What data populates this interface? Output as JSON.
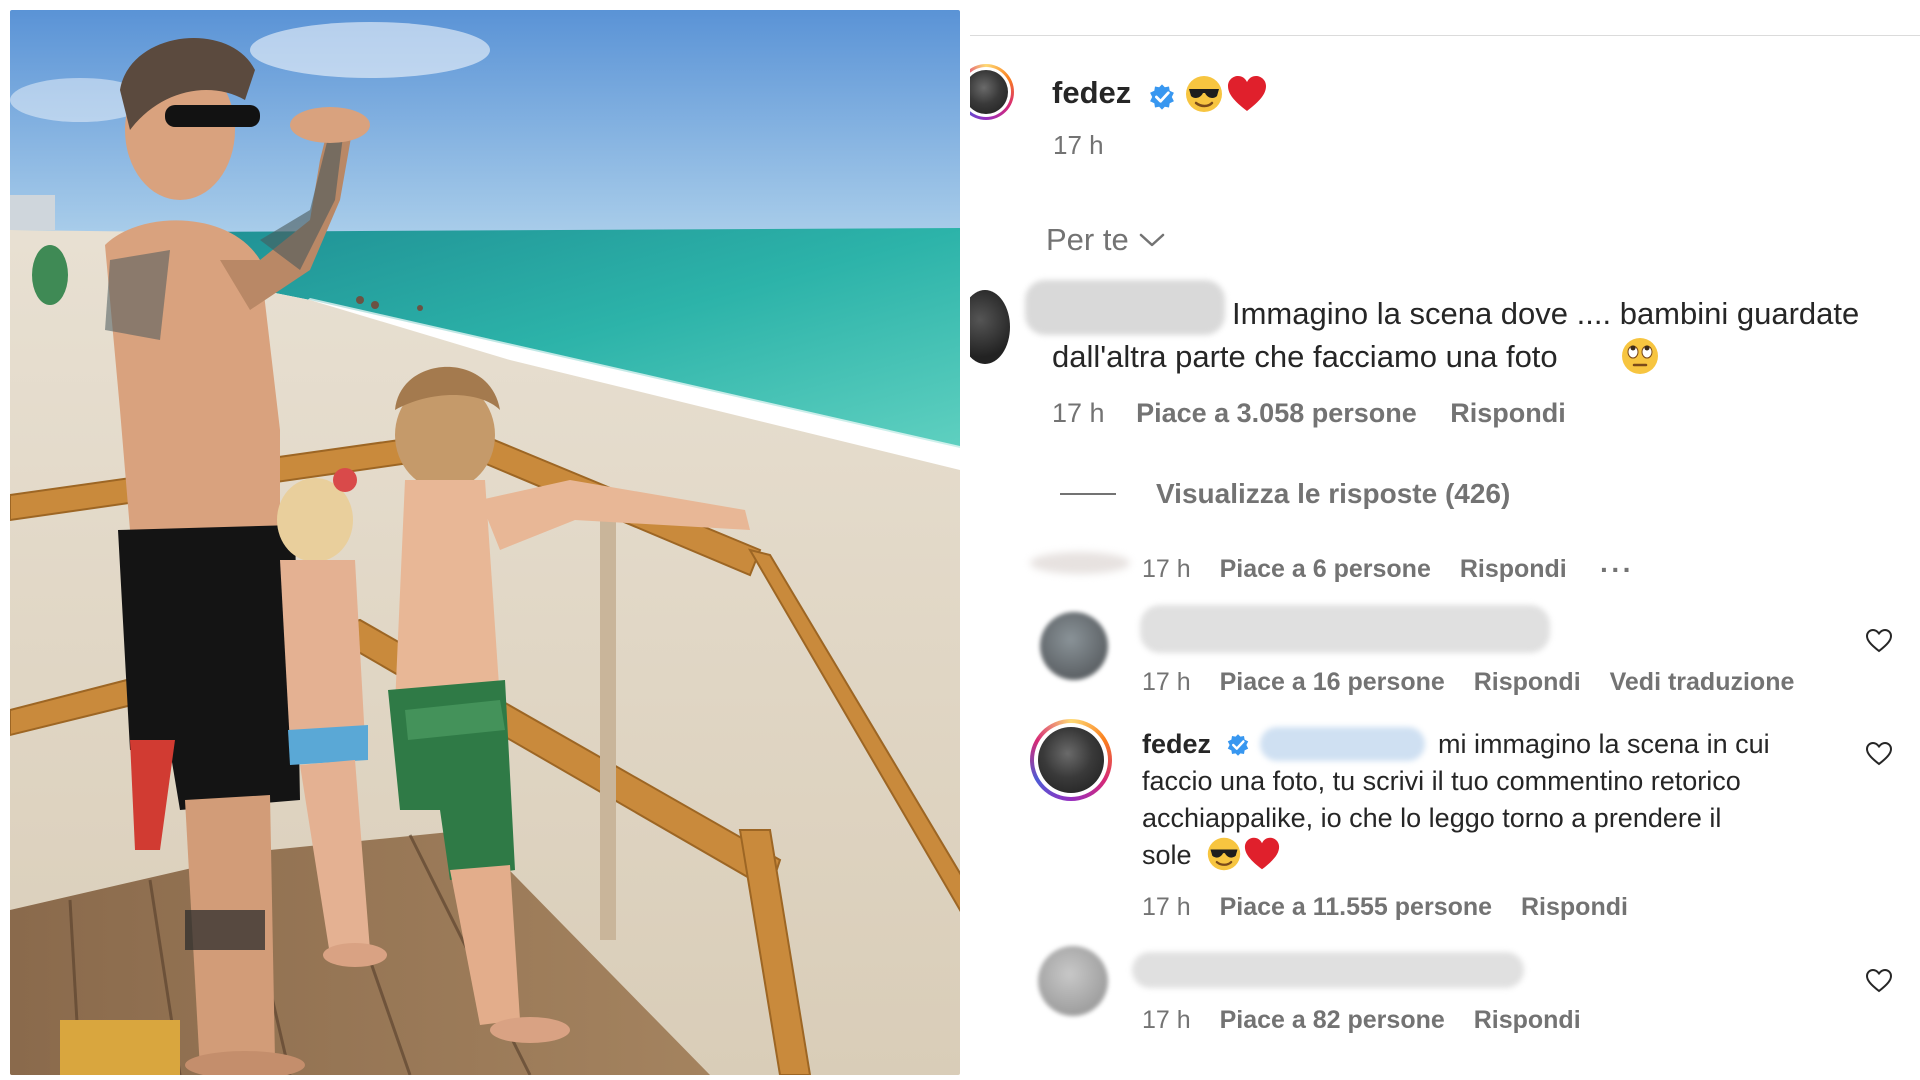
{
  "post": {
    "username": "fedez",
    "time": "17 h"
  },
  "filter": {
    "label": "Per te"
  },
  "comments": [
    {
      "text_line1": "Immagino la scena dove .... bambini guardate",
      "text_line2": "dall'altra parte che facciamo una foto",
      "time": "17 h",
      "likes": "Piace a 3.058 persone",
      "reply": "Rispondi"
    },
    {
      "time": "17 h",
      "likes": "Piace a 6 persone",
      "reply": "Rispondi"
    },
    {
      "time": "17 h",
      "likes": "Piace a 16 persone",
      "reply": "Rispondi",
      "translate": "Vedi traduzione"
    },
    {
      "username": "fedez",
      "text_line1": "mi immagino la scena in cui",
      "text_line2": "faccio una foto, tu scrivi il tuo commentino retorico",
      "text_line3": "acchiappalike, io che lo leggo torno a prendere il",
      "text_line4": "sole",
      "time": "17 h",
      "likes": "Piace a 11.555 persone",
      "reply": "Rispondi"
    },
    {
      "time": "17 h",
      "likes": "Piace a 82 persone",
      "reply": "Rispondi"
    }
  ],
  "replies_toggle": "Visualizza le risposte (426)",
  "colors": {
    "verified": "#3897f0",
    "meta_text": "#737373",
    "text": "#262626"
  }
}
